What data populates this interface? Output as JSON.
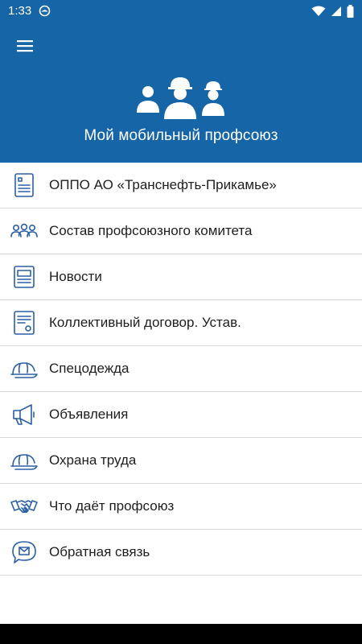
{
  "status_bar": {
    "time": "1:33"
  },
  "header": {
    "title": "Мой мобильный профсоюз"
  },
  "menu": [
    {
      "label": "ОППО АО «Транснефть-Прикамье»",
      "icon": "document-icon"
    },
    {
      "label": "Состав профсоюзного комитета",
      "icon": "people-group-icon"
    },
    {
      "label": "Новости",
      "icon": "newspaper-icon"
    },
    {
      "label": "Коллективный договор. Устав.",
      "icon": "contract-icon"
    },
    {
      "label": "Спецодежда",
      "icon": "hard-hat-icon"
    },
    {
      "label": "Объявления",
      "icon": "megaphone-icon"
    },
    {
      "label": "Охрана труда",
      "icon": "hard-hat-icon"
    },
    {
      "label": "Что даёт профсоюз",
      "icon": "handshake-icon"
    },
    {
      "label": "Обратная связь",
      "icon": "chat-icon"
    }
  ],
  "colors": {
    "header": "#1565a7",
    "icon": "#2b5fa8",
    "divider": "#d6d6d6"
  }
}
